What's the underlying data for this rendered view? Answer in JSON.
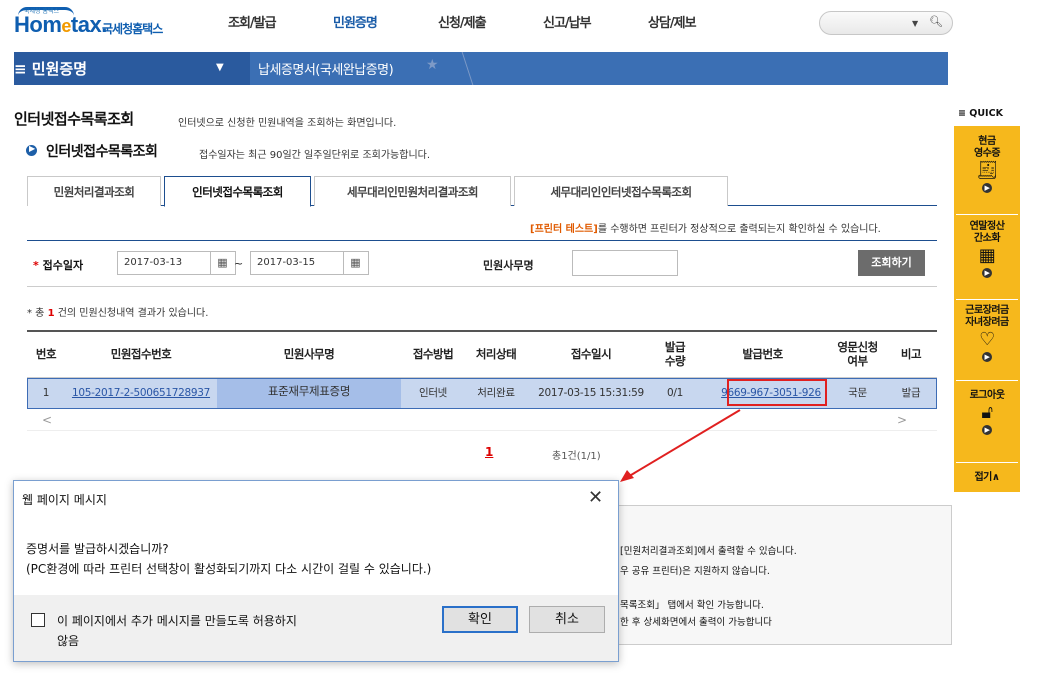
{
  "logo": {
    "small": "국세청 홈택스",
    "main_a": "Hom",
    "main_e": "e",
    "main_b": "tax.",
    "kr": "국세청홈택스"
  },
  "topnav": [
    "조회/발급",
    "민원증명",
    "신청/제출",
    "신고/납부",
    "상담/제보"
  ],
  "topnav_active": "민원증명",
  "menu": {
    "title": "≡ 민원증명",
    "crumb": "납세증명서(국세완납증명)"
  },
  "page": {
    "title": "인터넷접수목록조회",
    "subtitle": "인터넷으로 신청한 민원내역을 조회하는 화면입니다.",
    "section": "인터넷접수목록조회",
    "section_note": "접수일자는 최근 90일간 일주일단위로 조회가능합니다."
  },
  "tabs": [
    "민원처리결과조회",
    "인터넷접수목록조회",
    "세무대리인민원처리결과조회",
    "세무대리인인터넷접수목록조회"
  ],
  "printer_note_bold": "[프린터 테스트]",
  "printer_note": "를 수행하면 프린터가 정상적으로 출력되는지 확인하실 수 있습니다.",
  "form": {
    "date_label": "접수일자",
    "date_from": "2017-03-13",
    "date_to": "2017-03-15",
    "tilde": "~",
    "office_label": "민원사무명",
    "search_button": "조회하기"
  },
  "result": {
    "prefix": "* 총 ",
    "count": "1",
    "suffix": " 건의 민원신청내역 결과가 있습니다."
  },
  "table": {
    "headers": [
      "번호",
      "민원접수번호",
      "민원사무명",
      "접수방법",
      "처리상태",
      "접수일시",
      "발급\n수량",
      "발급번호",
      "영문신청\n여부",
      "비고"
    ],
    "row": [
      "1",
      "105-2017-2-500651728937",
      "표준재무제표증명",
      "인터넷",
      "처리완료",
      "2017-03-15 15:31:59",
      "0/1",
      "9669-967-3051-926",
      "국문",
      "발급"
    ]
  },
  "pagination": {
    "page": "1",
    "total": "총1건(1/1)"
  },
  "info_lines": [
    "[민원처리결과조회]에서 출력할 수 있습니다.",
    "우 공유 프린터)은 지원하지 않습니다.",
    "목록조회」 탭에서 확인 가능합니다.",
    "한 후 상세화면에서 출력이 가능합니다"
  ],
  "quick": {
    "title": "≡ QUICK",
    "items": [
      "현금\n영수증",
      "연말정산\n간소화",
      "근로장려금\n자녀장려금",
      "로그아웃",
      "접기∧"
    ]
  },
  "dialog": {
    "title": "웹 페이지 메시지",
    "close": "✕",
    "line1": "증명서를 발급하시겠습니까?",
    "line2": "(PC환경에 따라 프린터 선택창이 활성화되기까지 다소 시간이 걸릴 수 있습니다.)",
    "checkbox_line1": "이 페이지에서 추가 메시지를 만들도록 허용하지",
    "checkbox_line2": "않음",
    "ok": "확인",
    "cancel": "취소"
  },
  "colors": {
    "brand_blue": "#3b6fb4",
    "quick_yellow": "#f6b81c",
    "highlight": "#c8d7ef",
    "alert_red": "#e02020"
  }
}
